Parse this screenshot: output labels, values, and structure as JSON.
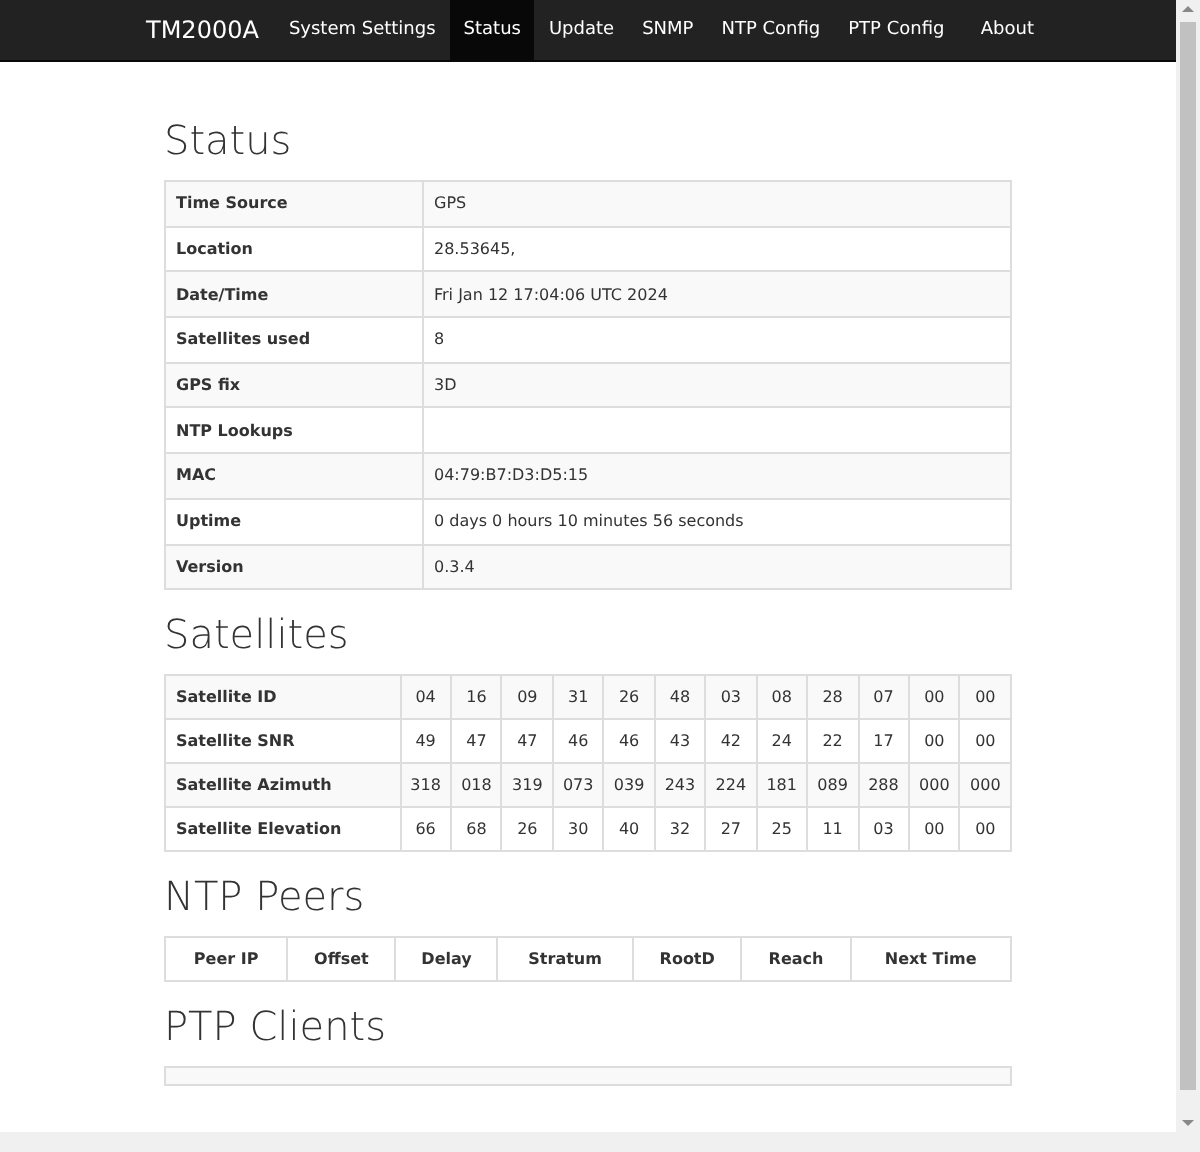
{
  "navbar": {
    "brand": "TM2000A",
    "items": [
      {
        "label": "System Settings",
        "selected": false
      },
      {
        "label": "Status",
        "selected": true
      },
      {
        "label": "Update",
        "selected": false
      },
      {
        "label": "SNMP",
        "selected": false
      },
      {
        "label": "NTP Config",
        "selected": false
      },
      {
        "label": "PTP Config",
        "selected": false
      }
    ],
    "right_item": {
      "label": "About",
      "selected": false
    }
  },
  "status": {
    "title": "Status",
    "rows": [
      {
        "label": "Time Source",
        "value": "GPS"
      },
      {
        "label": "Location",
        "value": "28.53645,"
      },
      {
        "label": "Date/Time",
        "value": "Fri Jan 12 17:04:06 UTC 2024"
      },
      {
        "label": "Satellites used",
        "value": "8"
      },
      {
        "label": "GPS fix",
        "value": "3D"
      },
      {
        "label": "NTP Lookups",
        "value": ""
      },
      {
        "label": "MAC",
        "value": "04:79:B7:D3:D5:15"
      },
      {
        "label": "Uptime",
        "value": "0 days 0 hours 10 minutes 56 seconds"
      },
      {
        "label": "Version",
        "value": "0.3.4"
      }
    ]
  },
  "satellites": {
    "title": "Satellites",
    "rows": [
      {
        "label": "Satellite ID",
        "values": [
          "04",
          "16",
          "09",
          "31",
          "26",
          "48",
          "03",
          "08",
          "28",
          "07",
          "00",
          "00"
        ]
      },
      {
        "label": "Satellite SNR",
        "values": [
          "49",
          "47",
          "47",
          "46",
          "46",
          "43",
          "42",
          "24",
          "22",
          "17",
          "00",
          "00"
        ]
      },
      {
        "label": "Satellite Azimuth",
        "values": [
          "318",
          "018",
          "319",
          "073",
          "039",
          "243",
          "224",
          "181",
          "089",
          "288",
          "000",
          "000"
        ]
      },
      {
        "label": "Satellite Elevation",
        "values": [
          "66",
          "68",
          "26",
          "30",
          "40",
          "32",
          "27",
          "25",
          "11",
          "03",
          "00",
          "00"
        ]
      }
    ]
  },
  "ntp_peers": {
    "title": "NTP Peers",
    "columns": [
      "Peer IP",
      "Offset",
      "Delay",
      "Stratum",
      "RootD",
      "Reach",
      "Next Time"
    ]
  },
  "ptp_clients": {
    "title": "PTP Clients"
  }
}
